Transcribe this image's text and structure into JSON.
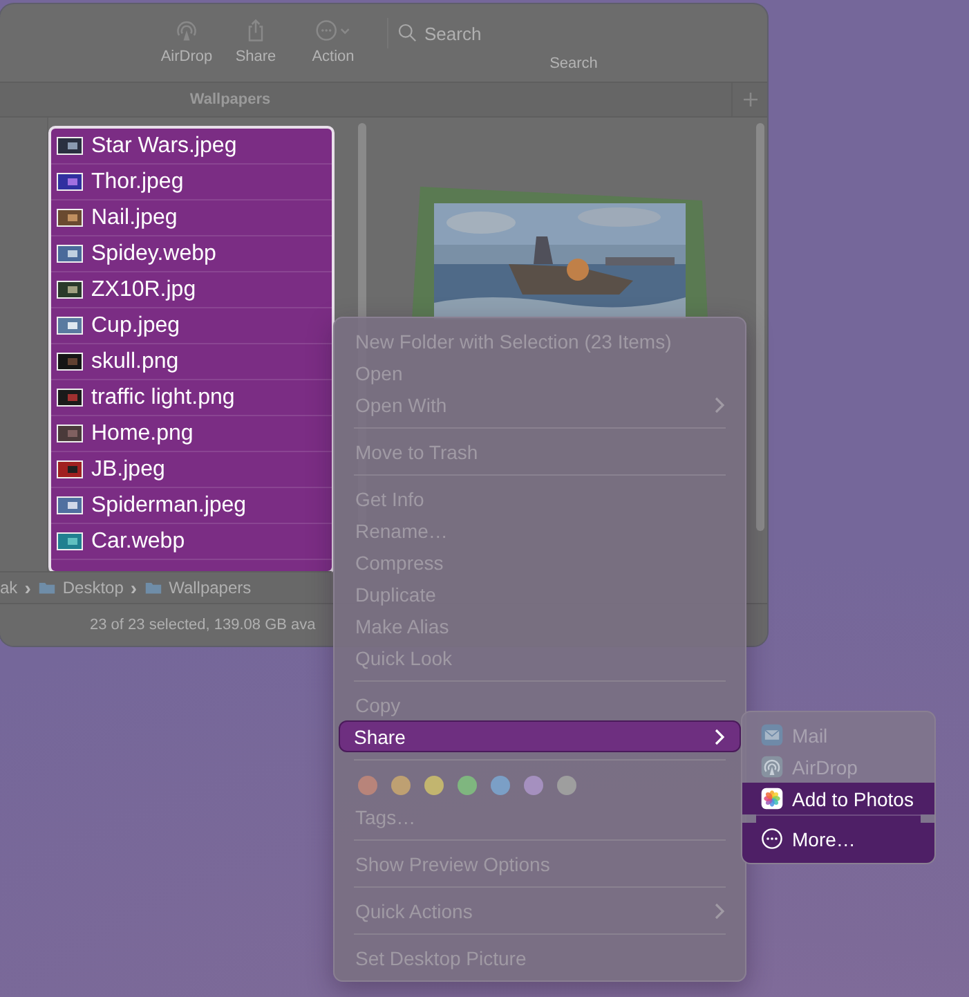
{
  "window": {
    "toolbar": [
      {
        "label": "AirDrop",
        "kind": "airdrop"
      },
      {
        "label": "Share",
        "kind": "share"
      },
      {
        "label": "Action",
        "kind": "action"
      }
    ],
    "search": {
      "placeholder": "Search",
      "label": "Search"
    },
    "tab": {
      "label": "Wallpapers"
    },
    "files": [
      {
        "name": "Star Wars.jpeg",
        "selected": true
      },
      {
        "name": "Thor.jpeg",
        "selected": true
      },
      {
        "name": "Nail.jpeg",
        "selected": true
      },
      {
        "name": "Spidey.webp",
        "selected": true
      },
      {
        "name": "ZX10R.jpg",
        "selected": true
      },
      {
        "name": "Cup.jpeg",
        "selected": true
      },
      {
        "name": "skull.png",
        "selected": true
      },
      {
        "name": "traffic light.png",
        "selected": true
      },
      {
        "name": "Home.png",
        "selected": true
      },
      {
        "name": "JB.jpeg",
        "selected": true
      },
      {
        "name": "Spiderman.jpeg",
        "selected": true
      },
      {
        "name": "Car.webp",
        "selected": true
      }
    ],
    "path": {
      "separator": "›",
      "items": [
        {
          "label": "ak",
          "kind": "plain"
        },
        {
          "label": "Desktop",
          "kind": "folder"
        },
        {
          "label": "Wallpapers",
          "kind": "folder"
        }
      ]
    },
    "status": "23 of 23 selected, 139.08 GB ava"
  },
  "context_menu": {
    "sections": [
      {
        "kind": "items",
        "items": [
          {
            "label": "New Folder with Selection (23 Items)",
            "submenu": false,
            "highlighted": false
          },
          {
            "label": "Open",
            "submenu": false,
            "highlighted": false
          },
          {
            "label": "Open With",
            "submenu": true,
            "highlighted": false
          }
        ]
      },
      {
        "kind": "items",
        "items": [
          {
            "label": "Move to Trash",
            "submenu": false,
            "highlighted": false
          }
        ]
      },
      {
        "kind": "items",
        "items": [
          {
            "label": "Get Info",
            "submenu": false,
            "highlighted": false
          },
          {
            "label": "Rename…",
            "submenu": false,
            "highlighted": false
          },
          {
            "label": "Compress",
            "submenu": false,
            "highlighted": false
          },
          {
            "label": "Duplicate",
            "submenu": false,
            "highlighted": false
          },
          {
            "label": "Make Alias",
            "submenu": false,
            "highlighted": false
          },
          {
            "label": "Quick Look",
            "submenu": false,
            "highlighted": false
          }
        ]
      },
      {
        "kind": "items",
        "items": [
          {
            "label": "Copy",
            "submenu": false,
            "highlighted": false
          },
          {
            "label": "Share",
            "submenu": true,
            "highlighted": true
          }
        ]
      },
      {
        "kind": "tags",
        "tags": [
          {
            "color": "#b8847a"
          },
          {
            "color": "#bea072"
          },
          {
            "color": "#c2b56f"
          },
          {
            "color": "#7fb67f"
          },
          {
            "color": "#7b9fc6"
          },
          {
            "color": "#a590bf"
          },
          {
            "color": "#9e9e9e"
          }
        ],
        "label": "Tags…"
      },
      {
        "kind": "items",
        "items": [
          {
            "label": "Show Preview Options",
            "submenu": false,
            "highlighted": false
          }
        ]
      },
      {
        "kind": "items",
        "items": [
          {
            "label": "Quick Actions",
            "submenu": true,
            "highlighted": false
          }
        ]
      },
      {
        "kind": "items",
        "items": [
          {
            "label": "Set Desktop Picture",
            "submenu": false,
            "highlighted": false
          }
        ]
      }
    ]
  },
  "share_menu": {
    "sections": [
      [
        {
          "label": "Mail",
          "kind": "mail",
          "highlighted": false
        },
        {
          "label": "AirDrop",
          "kind": "airdrop",
          "highlighted": false
        },
        {
          "label": "Add to Photos",
          "kind": "photos",
          "highlighted": true
        }
      ],
      [
        {
          "label": "More…",
          "kind": "more",
          "highlighted": true
        }
      ]
    ]
  }
}
